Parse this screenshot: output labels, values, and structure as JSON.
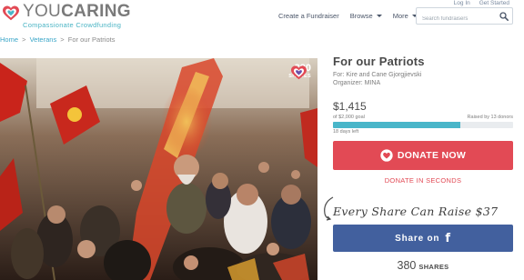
{
  "brand": {
    "name_light": "YOU",
    "name_bold": "CARING",
    "tagline": "Compassionate Crowdfunding",
    "heart_color": "#e24a55",
    "accent_color": "#49b6c9"
  },
  "header": {
    "util_links": [
      "Log In",
      "Get Started"
    ],
    "nav": {
      "create_label": "Create a Fundraiser",
      "browse_label": "Browse",
      "more_label": "More"
    },
    "search": {
      "placeholder": "Search fundraisers",
      "icon": "search-icon"
    }
  },
  "breadcrumb": {
    "home": "Home",
    "category": "Veterans",
    "current": "For our Patriots",
    "separator": ">"
  },
  "hero": {
    "share_count": "380",
    "share_label": "SHARES"
  },
  "campaign": {
    "title": "For our Patriots",
    "for_line": "For: Kire and Cane Gjorgjievski",
    "organizer_line": "Organizer: MINA",
    "raised": "$1,415",
    "goal": "of $2,000 goal",
    "donors": "Raised by 13 donors",
    "progress_fraction": 0.7075,
    "days_left": "18 days left"
  },
  "actions": {
    "donate_label": "DONATE NOW",
    "donate_sub": "DONATE IN SECONDS",
    "donate_color": "#e24a55",
    "every_share": "Every Share Can Raise $37",
    "share_label": "Share on",
    "share_icon": "f",
    "share_color": "#42609e",
    "shares_number": "380",
    "shares_label": "SHARES"
  }
}
